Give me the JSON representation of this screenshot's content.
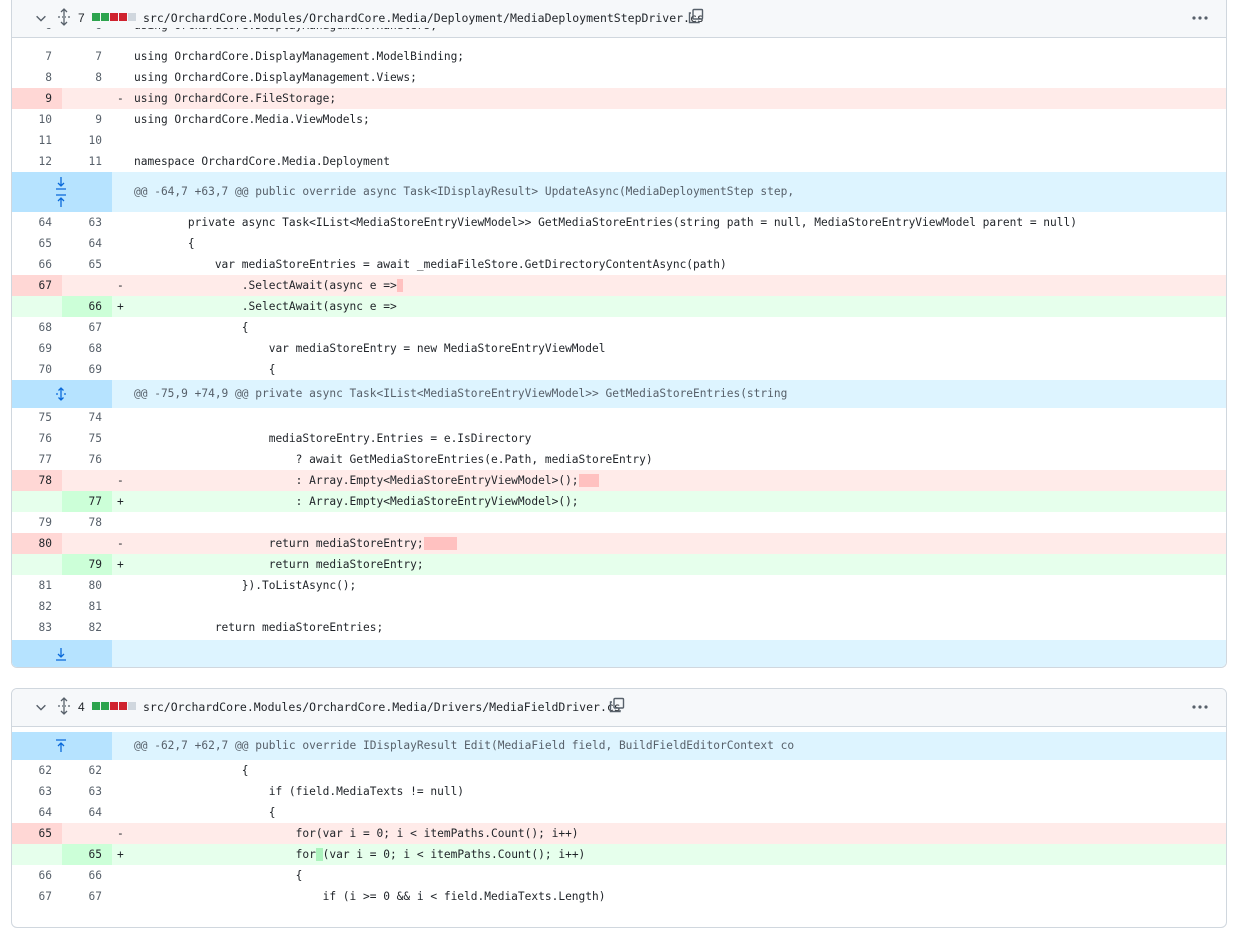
{
  "files": [
    {
      "count": "7",
      "blocks": [
        "add",
        "add",
        "del",
        "del",
        "neu"
      ],
      "path": "src/OrchardCore.Modules/OrchardCore.Media/Deployment/MediaDeploymentStepDriver.cs"
    },
    {
      "count": "4",
      "blocks": [
        "add",
        "add",
        "del",
        "del",
        "neu"
      ],
      "path": "src/OrchardCore.Modules/OrchardCore.Media/Drivers/MediaFieldDriver.cs"
    }
  ],
  "file1": {
    "partial_line": "using OrchardCore.DisplayManagement.Handlers;",
    "lines_a": [
      {
        "type": "ctx",
        "o": "7",
        "n": "7",
        "s": "",
        "c": "using OrchardCore.DisplayManagement.ModelBinding;"
      },
      {
        "type": "ctx",
        "o": "8",
        "n": "8",
        "s": "",
        "c": "using OrchardCore.DisplayManagement.Views;"
      },
      {
        "type": "del",
        "o": "9",
        "n": "",
        "s": "-",
        "c": "using OrchardCore.FileStorage;"
      },
      {
        "type": "ctx",
        "o": "10",
        "n": "9",
        "s": "",
        "c": "using OrchardCore.Media.ViewModels;"
      },
      {
        "type": "ctx",
        "o": "11",
        "n": "10",
        "s": "",
        "c": ""
      },
      {
        "type": "ctx",
        "o": "12",
        "n": "11",
        "s": "",
        "c": "namespace OrchardCore.Media.Deployment"
      }
    ],
    "hunk1": "@@ -64,7 +63,7 @@ public override async Task<IDisplayResult> UpdateAsync(MediaDeploymentStep step,",
    "lines_b": [
      {
        "type": "ctx",
        "o": "64",
        "n": "63",
        "s": "",
        "c": "        private async Task<IList<MediaStoreEntryViewModel>> GetMediaStoreEntries(string path = null, MediaStoreEntryViewModel parent = null)"
      },
      {
        "type": "ctx",
        "o": "65",
        "n": "64",
        "s": "",
        "c": "        {"
      },
      {
        "type": "ctx",
        "o": "66",
        "n": "65",
        "s": "",
        "c": "            var mediaStoreEntries = await _mediaFileStore.GetDirectoryContentAsync(path)"
      },
      {
        "type": "del",
        "o": "67",
        "n": "",
        "s": "-",
        "c": "                .SelectAwait(async e =>",
        "mark": " "
      },
      {
        "type": "add",
        "o": "",
        "n": "66",
        "s": "+",
        "c": "                .SelectAwait(async e =>"
      },
      {
        "type": "ctx",
        "o": "68",
        "n": "67",
        "s": "",
        "c": "                {"
      },
      {
        "type": "ctx",
        "o": "69",
        "n": "68",
        "s": "",
        "c": "                    var mediaStoreEntry = new MediaStoreEntryViewModel"
      },
      {
        "type": "ctx",
        "o": "70",
        "n": "69",
        "s": "",
        "c": "                    {"
      }
    ],
    "hunk2": "@@ -75,9 +74,9 @@ private async Task<IList<MediaStoreEntryViewModel>> GetMediaStoreEntries(string",
    "lines_c": [
      {
        "type": "ctx",
        "o": "75",
        "n": "74",
        "s": "",
        "c": ""
      },
      {
        "type": "ctx",
        "o": "76",
        "n": "75",
        "s": "",
        "c": "                    mediaStoreEntry.Entries = e.IsDirectory"
      },
      {
        "type": "ctx",
        "o": "77",
        "n": "76",
        "s": "",
        "c": "                        ? await GetMediaStoreEntries(e.Path, mediaStoreEntry)"
      },
      {
        "type": "del",
        "o": "78",
        "n": "",
        "s": "-",
        "c": "                        : Array.Empty<MediaStoreEntryViewModel>();",
        "mark": "   "
      },
      {
        "type": "add",
        "o": "",
        "n": "77",
        "s": "+",
        "c": "                        : Array.Empty<MediaStoreEntryViewModel>();"
      },
      {
        "type": "ctx",
        "o": "79",
        "n": "78",
        "s": "",
        "c": ""
      },
      {
        "type": "del",
        "o": "80",
        "n": "",
        "s": "-",
        "c": "                    return mediaStoreEntry;",
        "mark": "     "
      },
      {
        "type": "add",
        "o": "",
        "n": "79",
        "s": "+",
        "c": "                    return mediaStoreEntry;"
      },
      {
        "type": "ctx",
        "o": "81",
        "n": "80",
        "s": "",
        "c": "                }).ToListAsync();"
      },
      {
        "type": "ctx",
        "o": "82",
        "n": "81",
        "s": "",
        "c": ""
      },
      {
        "type": "ctx",
        "o": "83",
        "n": "82",
        "s": "",
        "c": "            return mediaStoreEntries;"
      }
    ]
  },
  "file2": {
    "hunk1": "@@ -62,7 +62,7 @@ public override IDisplayResult Edit(MediaField field, BuildFieldEditorContext co",
    "lines": [
      {
        "type": "ctx",
        "o": "62",
        "n": "62",
        "s": "",
        "c": "                {"
      },
      {
        "type": "ctx",
        "o": "63",
        "n": "63",
        "s": "",
        "c": "                    if (field.MediaTexts != null)"
      },
      {
        "type": "ctx",
        "o": "64",
        "n": "64",
        "s": "",
        "c": "                    {"
      },
      {
        "type": "del",
        "o": "65",
        "n": "",
        "s": "-",
        "c": "                        for(var i = 0; i < itemPaths.Count(); i++)"
      },
      {
        "type": "add",
        "o": "",
        "n": "65",
        "s": "+",
        "c": "                        for",
        "mark": " ",
        "c2": "(var i = 0; i < itemPaths.Count(); i++)"
      },
      {
        "type": "ctx",
        "o": "66",
        "n": "66",
        "s": "",
        "c": "                        {"
      },
      {
        "type": "ctx",
        "o": "67",
        "n": "67",
        "s": "",
        "c": "                            if (i >= 0 && i < field.MediaTexts.Length)"
      }
    ]
  }
}
